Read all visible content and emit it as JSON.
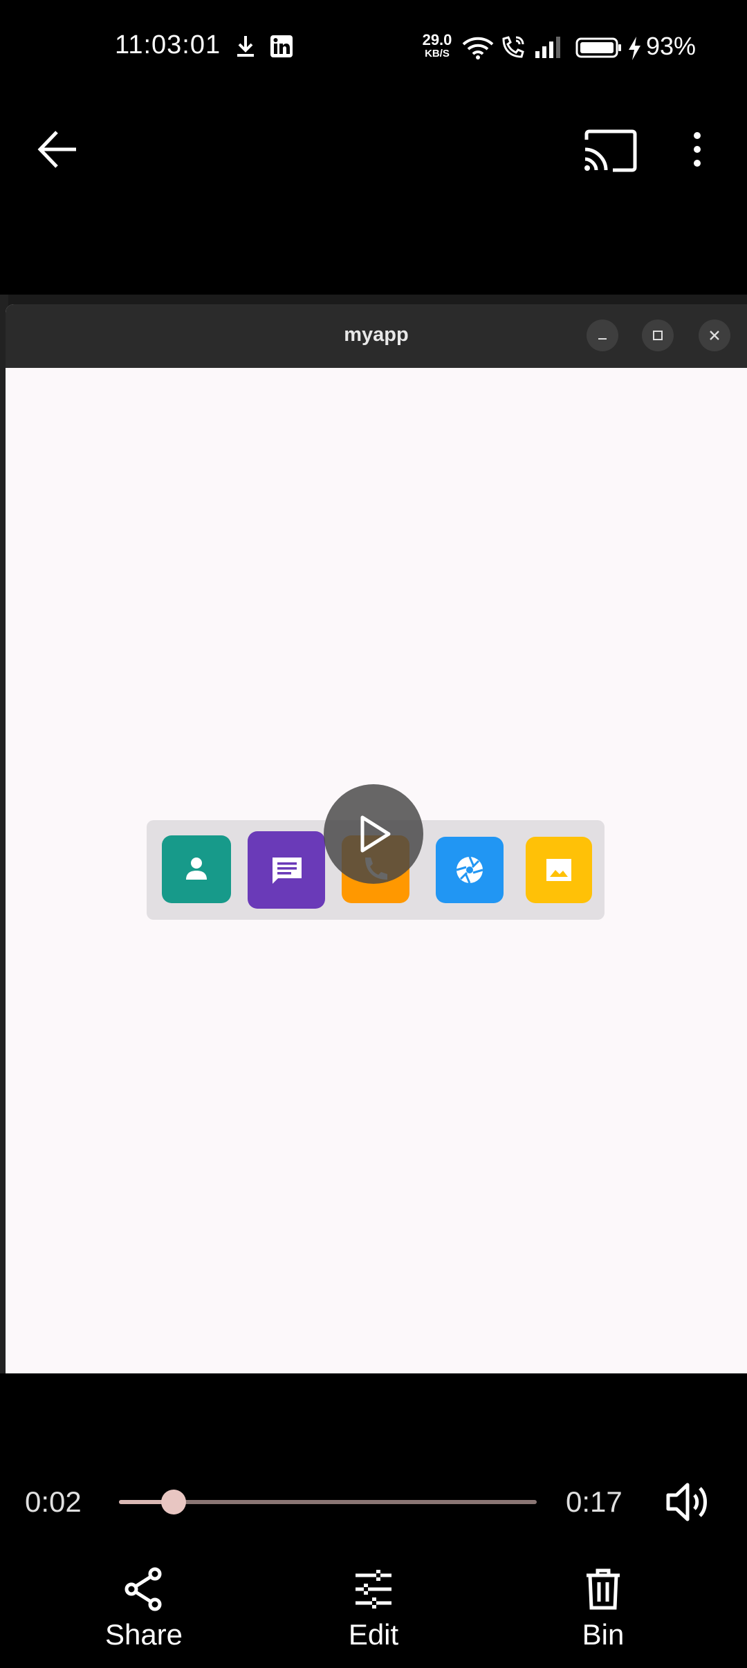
{
  "status_bar": {
    "time": "11:03:01",
    "net_speed_value": "29.0",
    "net_speed_unit": "KB/S",
    "battery_percent": "93%",
    "icons": [
      "download-icon",
      "linkedin-icon",
      "wifi-icon",
      "volte-call-icon",
      "signal-icon",
      "battery-icon",
      "charging-icon"
    ]
  },
  "toolbar": {
    "icons": [
      "back-arrow-icon",
      "cast-icon",
      "more-vert-icon"
    ]
  },
  "video": {
    "window_title": "myapp",
    "window_controls": [
      "minimize-icon",
      "maximize-icon",
      "close-icon"
    ],
    "dock_apps": [
      {
        "name": "contacts",
        "color": "#179a8a"
      },
      {
        "name": "messages",
        "color": "#6a3ab8"
      },
      {
        "name": "phone",
        "color": "#ff9800"
      },
      {
        "name": "camera",
        "color": "#2196f3"
      },
      {
        "name": "gallery",
        "color": "#ffc107"
      }
    ]
  },
  "player": {
    "current_time": "0:02",
    "total_time": "0:17",
    "progress": 0.13
  },
  "actions": {
    "share_label": "Share",
    "edit_label": "Edit",
    "bin_label": "Bin"
  },
  "colors": {
    "background": "#000000",
    "seek_track": "#8a7674",
    "seek_thumb": "#e8c6c2",
    "app_background": "#fcf8fa",
    "titlebar": "#2b2b2b"
  }
}
